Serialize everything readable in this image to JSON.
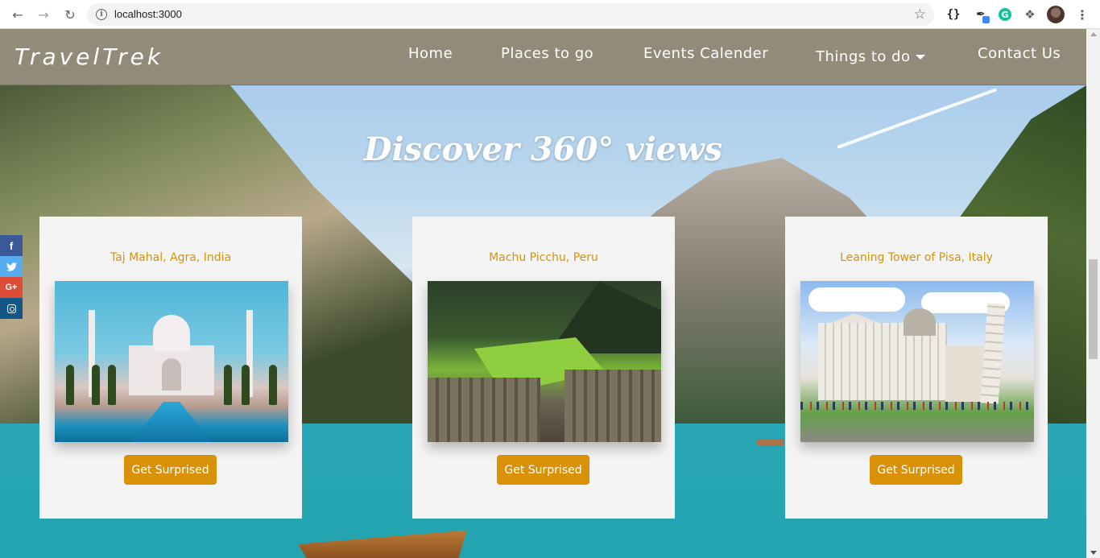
{
  "browser": {
    "url": "localhost:3000"
  },
  "navbar": {
    "brand": "TravelTrek",
    "links": {
      "home": "Home",
      "places": "Places to go",
      "events": "Events Calender",
      "things": "Things to do",
      "contact": "Contact Us"
    }
  },
  "hero": {
    "title": "Discover 360° views"
  },
  "social": {
    "facebook": "f",
    "twitter": "t",
    "google_plus": "G+"
  },
  "cards": [
    {
      "title": "Taj Mahal, Agra, India",
      "button": "Get Surprised"
    },
    {
      "title": "Machu Picchu, Peru",
      "button": "Get Surprised"
    },
    {
      "title": "Leaning Tower of Pisa, Italy",
      "button": "Get Surprised"
    }
  ],
  "colors": {
    "navbar_bg": "#928b7a",
    "card_title": "#d4930c",
    "button_bg": "#d99208",
    "card_bg": "#f4f4f4"
  }
}
